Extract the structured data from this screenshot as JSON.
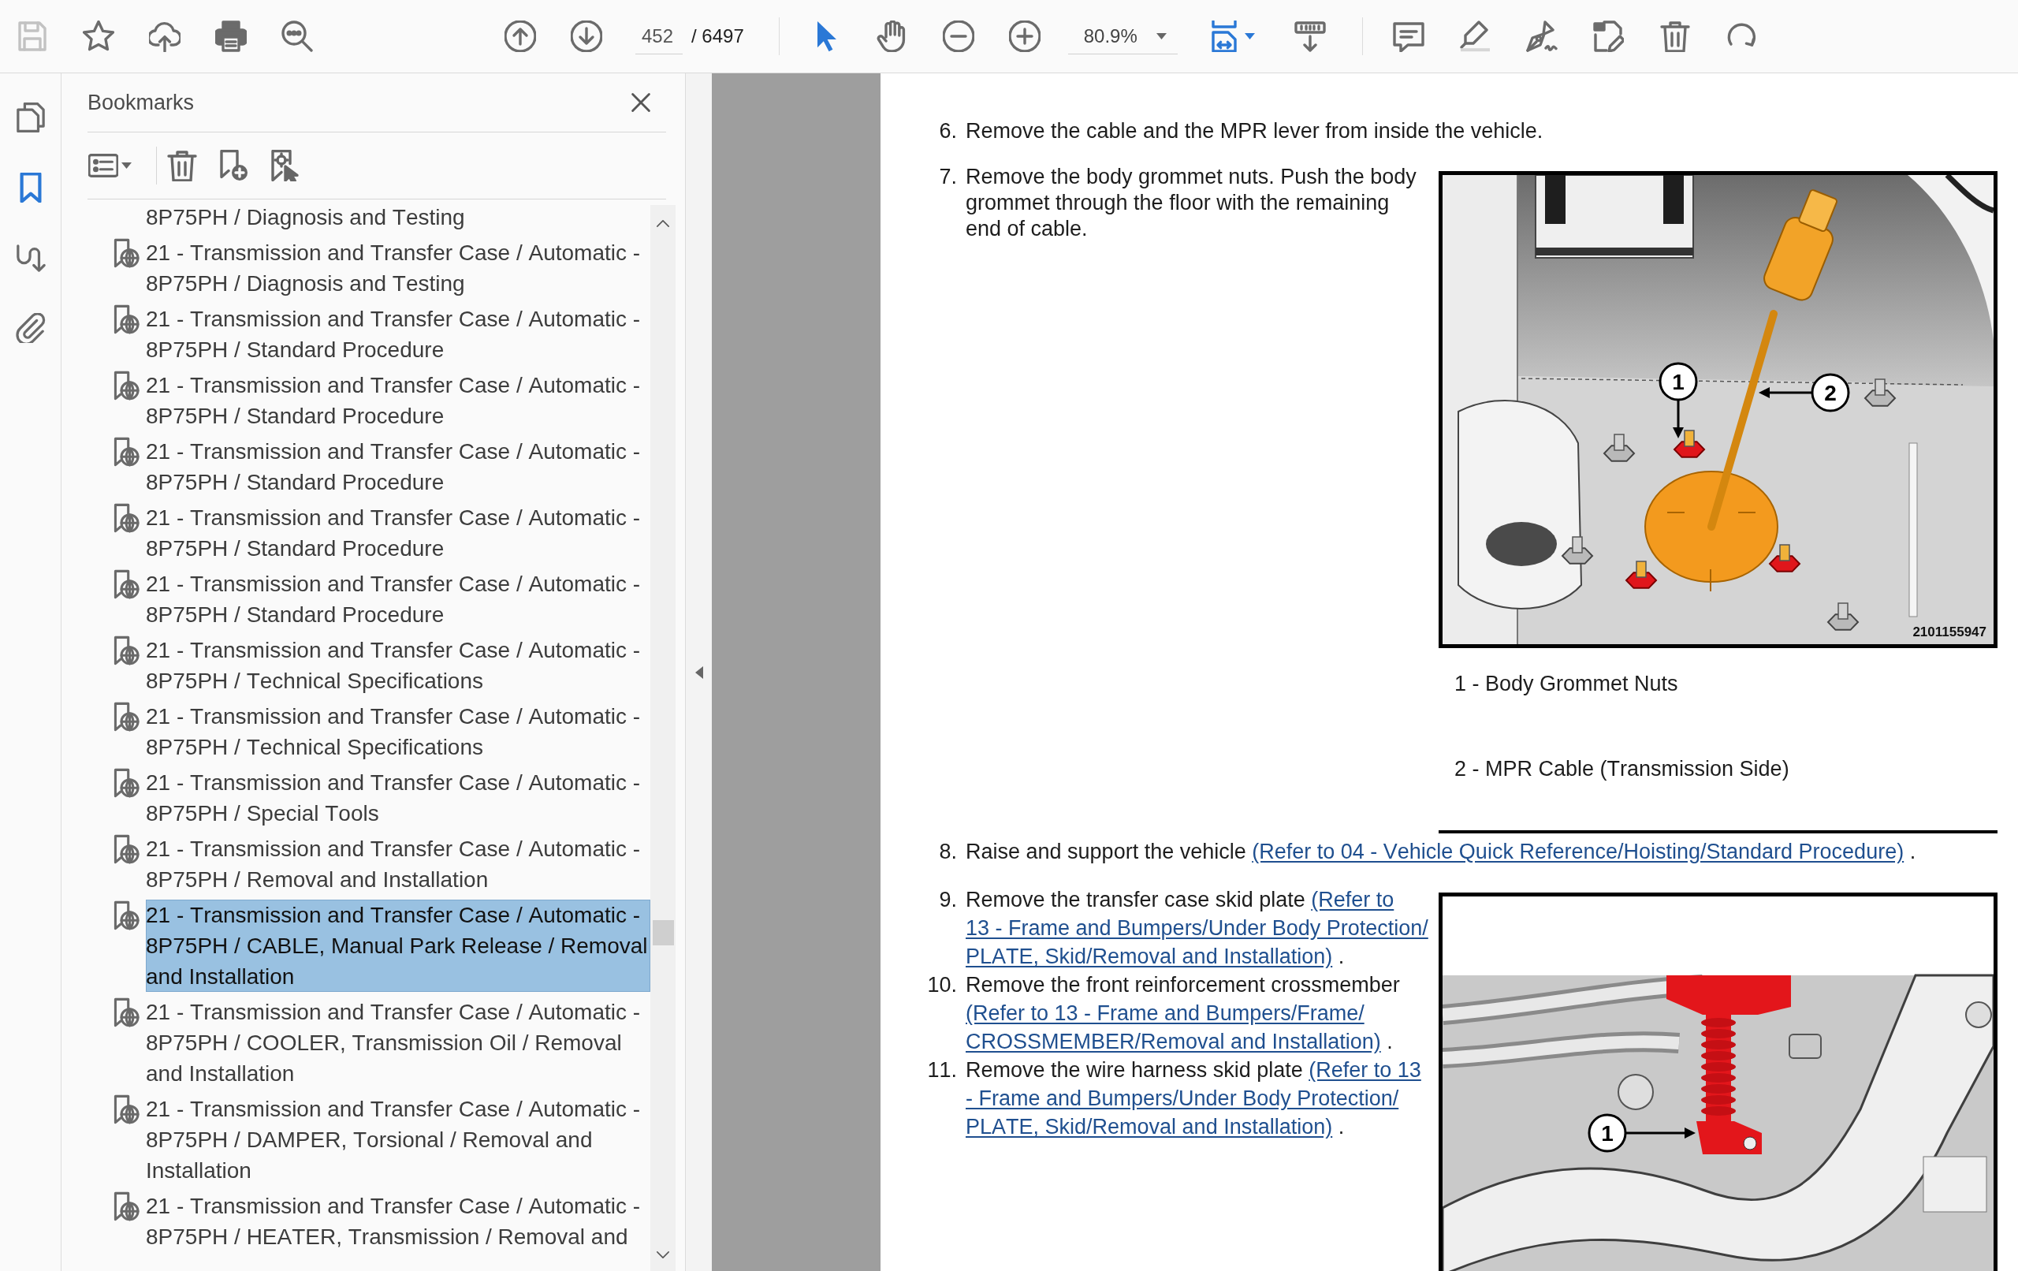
{
  "toolbar": {
    "file_tools": [
      {
        "kind": "save",
        "disabled": true
      },
      {
        "kind": "star",
        "disabled": false
      },
      {
        "kind": "upload",
        "disabled": false
      },
      {
        "kind": "print",
        "disabled": false
      },
      {
        "kind": "find",
        "disabled": false
      }
    ],
    "page_number": "452",
    "page_total": "/ 6497",
    "mode_tools": [
      {
        "kind": "select",
        "selected": true
      },
      {
        "kind": "hand",
        "selected": false
      }
    ],
    "zoom": "80.9%"
  },
  "rail": [
    {
      "kind": "pages",
      "selected": false
    },
    {
      "kind": "bookmarks",
      "selected": true
    },
    {
      "kind": "signatures",
      "selected": false
    },
    {
      "kind": "attachments",
      "selected": false
    }
  ],
  "bookmarks": {
    "title": "Bookmarks",
    "items": [
      {
        "kind": "continuation",
        "text": "8P75PH / Diagnosis and Testing",
        "selected": false
      },
      {
        "kind": "bookmark",
        "text": "21 - Transmission and Transfer Case / Automatic - 8P75PH / Diagnosis and Testing",
        "selected": false
      },
      {
        "kind": "bookmark",
        "text": "21 - Transmission and Transfer Case / Automatic - 8P75PH / Standard Procedure",
        "selected": false
      },
      {
        "kind": "bookmark",
        "text": "21 - Transmission and Transfer Case / Automatic - 8P75PH / Standard Procedure",
        "selected": false
      },
      {
        "kind": "bookmark",
        "text": "21 - Transmission and Transfer Case / Automatic - 8P75PH / Standard Procedure",
        "selected": false
      },
      {
        "kind": "bookmark",
        "text": "21 - Transmission and Transfer Case / Automatic - 8P75PH / Standard Procedure",
        "selected": false
      },
      {
        "kind": "bookmark",
        "text": "21 - Transmission and Transfer Case / Automatic - 8P75PH / Standard Procedure",
        "selected": false
      },
      {
        "kind": "bookmark",
        "text": "21 - Transmission and Transfer Case / Automatic - 8P75PH / Technical Specifications",
        "selected": false
      },
      {
        "kind": "bookmark",
        "text": "21 - Transmission and Transfer Case / Automatic - 8P75PH / Technical Specifications",
        "selected": false
      },
      {
        "kind": "bookmark",
        "text": "21 - Transmission and Transfer Case / Automatic - 8P75PH / Special Tools",
        "selected": false
      },
      {
        "kind": "bookmark",
        "text": "21 - Transmission and Transfer Case / Automatic - 8P75PH / Removal and Installation",
        "selected": false
      },
      {
        "kind": "bookmark",
        "text": "21 - Transmission and Transfer Case / Automatic - 8P75PH / CABLE, Manual Park Release / Removal and Installation",
        "selected": true
      },
      {
        "kind": "bookmark",
        "text": "21 - Transmission and Transfer Case / Automatic - 8P75PH / COOLER, Transmission Oil / Removal and Installation",
        "selected": false
      },
      {
        "kind": "bookmark",
        "text": "21 - Transmission and Transfer Case / Automatic - 8P75PH / DAMPER, Torsional / Removal and Installation",
        "selected": false
      },
      {
        "kind": "bookmark",
        "text": "21 - Transmission and Transfer Case / Automatic - 8P75PH / HEATER, Transmission / Removal and",
        "selected": false
      }
    ]
  },
  "document": {
    "blocks": [
      {
        "kind": "step",
        "number": "6.",
        "text": "Remove the cable and the MPR lever from inside the vehicle."
      },
      {
        "kind": "figure_row",
        "steps": [
          {
            "number": "7.",
            "text": "Remove the body grommet nuts. Push the body grommet through the floor with the remaining end of cable."
          }
        ],
        "figure": {
          "kind": "grommet",
          "callouts": [
            "1",
            "2"
          ],
          "figure_number": "2101155947",
          "captions": [
            "1 - Body Grommet Nuts",
            "2 - MPR Cable (Transmission Side)"
          ]
        }
      },
      {
        "kind": "step",
        "number": "8.",
        "text": "Raise and support the vehicle",
        "link": [
          "(Refer to 04 - Vehicle Quick Reference/Hoisting/Standard Procedure)"
        ],
        "end": "."
      },
      {
        "kind": "figure_row",
        "steps": [
          {
            "number": "9.",
            "text": "Remove the transfer case skid plate",
            "link": [
              "(Refer to",
              "13 - Frame and Bumpers/Under Body Protection/",
              "PLATE, Skid/Removal and Installation)"
            ],
            "end": "."
          },
          {
            "number": "10.",
            "text": "Remove the front reinforcement crossmember",
            "link": [
              "(Refer to 13 - Frame and Bumpers/Frame/",
              "CROSSMEMBER/Removal and Installation)"
            ],
            "end": "."
          },
          {
            "number": "11.",
            "text": "Remove the wire harness skid plate",
            "link": [
              "(Refer to 13",
              "- Frame and Bumpers/Under Body Protection/",
              "PLATE, Skid/Removal and Installation)"
            ],
            "end": "."
          }
        ],
        "figure": {
          "kind": "crossmember",
          "callouts": [
            "1"
          ]
        }
      }
    ]
  }
}
